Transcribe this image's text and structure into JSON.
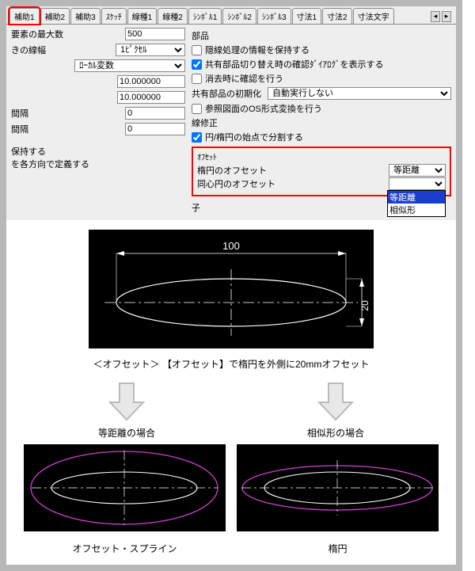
{
  "tabs": {
    "t0": "補助1",
    "t1": "補助2",
    "t2": "補助3",
    "t3": "ｽｹｯﾁ",
    "t4": "線種1",
    "t5": "線種2",
    "t6": "ｼﾝﾎﾞﾙ1",
    "t7": "ｼﾝﾎﾞﾙ2",
    "t8": "ｼﾝﾎﾞﾙ3",
    "t9": "寸法1",
    "t10": "寸法2",
    "t11": "寸法文字"
  },
  "left": {
    "maxElements_label": "要素の最大数",
    "maxElements_value": "500",
    "lineWidth_label": "きの線幅",
    "lineWidth_value": "1ﾋﾟｸｾﾙ",
    "varType_value": "ﾛｰｶﾙ変数",
    "num1": "10.000000",
    "num2": "10.000000",
    "spacing_label": "間隔",
    "spacing_value": "0",
    "spacing2_label": "間隔",
    "spacing2_value": "0",
    "keep_label": "保持する",
    "define_label": "を各方向で定義する"
  },
  "right": {
    "section_parts": "部品",
    "chk_hidden": "隠線処理の情報を保持する",
    "chk_shared_confirm": "共有部品切り替え時の確認ﾀﾞｲｱﾛｸﾞを表示する",
    "chk_erase_confirm": "消去時に確認を行う",
    "init_label": "共有部品の初期化",
    "init_value": "自動実行しない",
    "chk_os_convert": "参照図面のOS形式変換を行う",
    "section_linemod": "線修正",
    "chk_split_start": "円/楕円の始点で分割する",
    "offset_title": "ｵﾌｾｯﾄ",
    "ellipse_offset_label": "楕円のオフセット",
    "ellipse_offset_value": "等距離",
    "concentric_offset_label": "同心円のオフセット",
    "dd_opt_sel": "等距離",
    "dd_opt_2": "相似形",
    "sub_child": "子"
  },
  "illus": {
    "dim_w": "100",
    "dim_h": "20",
    "cap_main": "＜オフセット＞ 【オフセット】で楕円を外側に20mmオフセット",
    "case_left": "等距離の場合",
    "case_right": "相似形の場合",
    "bottom_left": "オフセット・スプライン",
    "bottom_right": "楕円"
  }
}
